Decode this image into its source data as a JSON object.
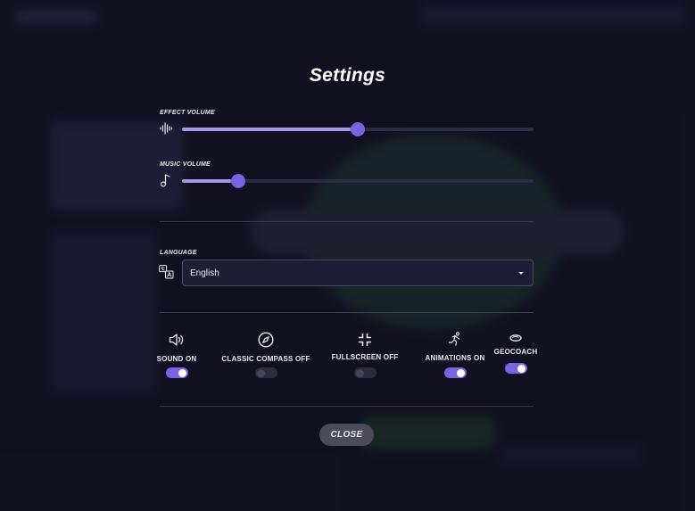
{
  "title": "Settings",
  "effect_volume": {
    "label": "EFFECT VOLUME",
    "value": 0.5,
    "icon": "waveform-icon"
  },
  "music_volume": {
    "label": "MUSIC VOLUME",
    "value": 0.16,
    "icon": "music-note-icon"
  },
  "language": {
    "label": "LANGUAGE",
    "selected": "English",
    "icon": "translate-icon"
  },
  "toggles": [
    {
      "label": "SOUND ON",
      "on": true,
      "icon": "speaker-icon"
    },
    {
      "label": "CLASSIC COMPASS OFF",
      "on": false,
      "icon": "compass-icon"
    },
    {
      "label": "FULLSCREEN OFF",
      "on": false,
      "icon": "exit-fullscreen-icon"
    },
    {
      "label": "ANIMATIONS ON",
      "on": true,
      "icon": "running-figure-icon"
    },
    {
      "label": "GEOCOACH",
      "on": true,
      "icon": "coach-disc-icon"
    }
  ],
  "close_label": "CLOSE",
  "colors": {
    "accent": "#7a63e0",
    "fill": "#a797e6",
    "background": "#171728"
  }
}
